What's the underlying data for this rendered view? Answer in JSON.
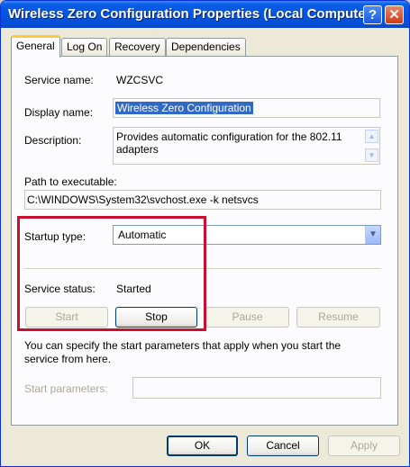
{
  "window": {
    "title": "Wireless Zero Configuration Properties (Local Computer)",
    "help_glyph": "?",
    "close_glyph": "✕"
  },
  "tabs": [
    {
      "label": "General",
      "active": true
    },
    {
      "label": "Log On",
      "active": false
    },
    {
      "label": "Recovery",
      "active": false
    },
    {
      "label": "Dependencies",
      "active": false
    }
  ],
  "general": {
    "service_name_label": "Service name:",
    "service_name_value": "WZCSVC",
    "display_name_label": "Display name:",
    "display_name_value": "Wireless Zero Configuration",
    "description_label": "Description:",
    "description_value": "Provides automatic configuration for the 802.11 adapters",
    "path_label": "Path to executable:",
    "path_value": "C:\\WINDOWS\\System32\\svchost.exe -k netsvcs",
    "startup_type_label": "Startup type:",
    "startup_type_value": "Automatic",
    "service_status_label": "Service status:",
    "service_status_value": "Started",
    "start_label": "Start",
    "stop_label": "Stop",
    "pause_label": "Pause",
    "resume_label": "Resume",
    "params_help_text": "You can specify the start parameters that apply when you start the service from here.",
    "start_params_label": "Start parameters:",
    "start_params_value": ""
  },
  "footer": {
    "ok_label": "OK",
    "cancel_label": "Cancel",
    "apply_label": "Apply"
  },
  "colors": {
    "highlight_box": "#c8102e",
    "title_bar": "#0454e0"
  }
}
